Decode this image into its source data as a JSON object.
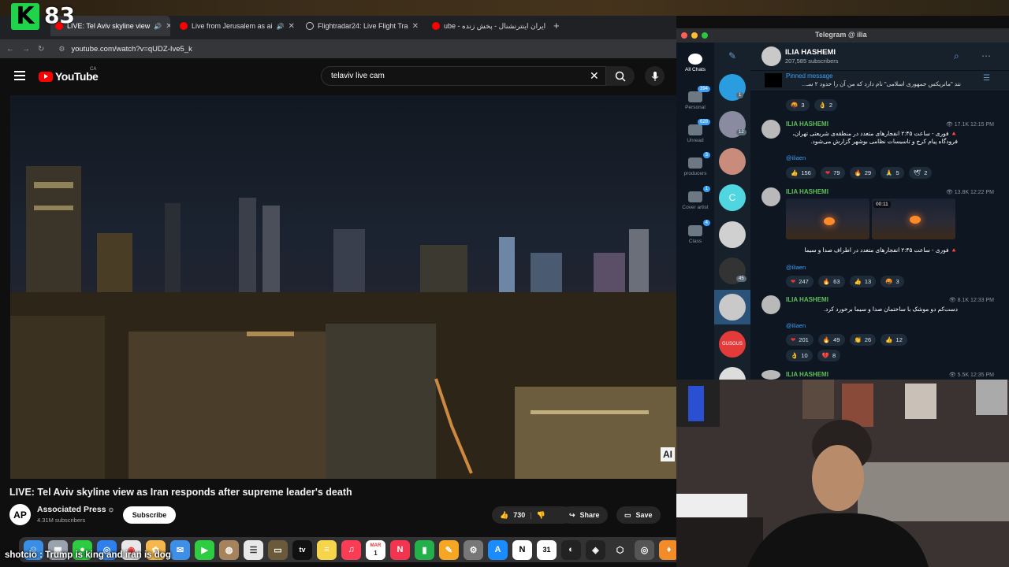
{
  "overlay": {
    "k_letter": "K",
    "count": "83",
    "ticker": "shotcio : Trump is king and iran is dog"
  },
  "browser": {
    "tabs": [
      {
        "label": "LIVE: Tel Aviv skyline view",
        "active": true
      },
      {
        "label": "Live from Jerusalem as ai",
        "active": false
      },
      {
        "label": "Flightradar24: Live Flight Tra",
        "active": false
      },
      {
        "label": "ube - ایران اینترنشنال - پخش زنده",
        "active": false
      }
    ],
    "url": "youtube.com/watch?v=qUDZ-Ive5_k"
  },
  "youtube": {
    "logo_text": "YouTube",
    "region": "CA",
    "search_value": "telaviv live cam",
    "video": {
      "title": "LIVE: Tel Aviv skyline view as Iran responds after supreme leader's death",
      "watermark": "AI"
    },
    "channel": {
      "avatar": "AP",
      "name": "Associated Press",
      "subscribers": "4.31M subscribers",
      "subscribe_label": "Subscribe"
    },
    "actions": {
      "likes": "730",
      "share": "Share",
      "save": "Save"
    }
  },
  "dock": {
    "icons": [
      "finder",
      "launchpad",
      "messages-app",
      "safari",
      "chrome",
      "photos",
      "mail",
      "facetime",
      "contacts",
      "calendar-notes",
      "folder",
      "appletv",
      "notes",
      "music",
      "calendar",
      "news",
      "numbers",
      "sketch",
      "system-preferences",
      "appstore",
      "notion",
      "calendar-31",
      "activity",
      "davinci",
      "unity",
      "disk",
      "fl-studio"
    ],
    "appletv_label": "tv",
    "notion_label": "N",
    "calendar_label": "31",
    "music_label": "MAR",
    "calendar_day": "1"
  },
  "telegram": {
    "window_title": "Telegram @ ilia",
    "folders": [
      {
        "label": "All Chats",
        "badge": ""
      },
      {
        "label": "Personal",
        "badge": "394"
      },
      {
        "label": "Unread",
        "badge": "628"
      },
      {
        "label": "producers",
        "badge": "3"
      },
      {
        "label": "Cover artist",
        "badge": "1"
      },
      {
        "label": "Class",
        "badge": "4"
      }
    ],
    "chat_badges": [
      "1",
      "12",
      "45"
    ],
    "chat_avatar_letter": "C",
    "chat_avatar_logo": "GUSGUS",
    "channel": {
      "name": "ILIA HASHEMI",
      "subscribers": "207,585 subscribers"
    },
    "pinned": {
      "label": "Pinned message",
      "text": "نتد \"ماتریکس جمهوری اسلامی\" نام دارد که من آن را حدود ۲ سـ..."
    },
    "pinned_reactions": [
      {
        "emoji": "🤬",
        "count": "3"
      },
      {
        "emoji": "👌",
        "count": "2"
      }
    ],
    "messages": [
      {
        "author": "ILIA HASHEMI",
        "views": "17.1K",
        "time": "12:15 PM",
        "text": "🔺 فوری - ساعت ۲:۴۵ انفجارهای متعدد در منطقه‌ی شریعتی تهران، فرودگاه پیام کرج و تاسیسات نظامی بوشهر گزارش می‌شود.",
        "handle": "@iliaen",
        "reactions": [
          {
            "emoji": "👍",
            "count": "156"
          },
          {
            "emoji": "❤",
            "count": "79"
          },
          {
            "emoji": "🔥",
            "count": "29"
          },
          {
            "emoji": "🙏",
            "count": "5"
          },
          {
            "emoji": "🕊",
            "count": "2"
          }
        ]
      },
      {
        "author": "ILIA HASHEMI",
        "views": "13.8K",
        "time": "12:22 PM",
        "video_duration": "00:11",
        "text": "🔺 فوری - ساعت ۲:۴۵ انفجارهای متعدد در اطراف صدا و سیما",
        "handle": "@iliaen",
        "reactions": [
          {
            "emoji": "❤",
            "count": "247"
          },
          {
            "emoji": "🔥",
            "count": "63"
          },
          {
            "emoji": "👍",
            "count": "13"
          },
          {
            "emoji": "🤬",
            "count": "3"
          }
        ]
      },
      {
        "author": "ILIA HASHEMI",
        "views": "8.1K",
        "time": "12:33 PM",
        "text": "دست‌کم دو موشک با ساختمان صدا و سیما برخورد کرد.",
        "handle": "@iliaen",
        "reactions": [
          {
            "emoji": "❤",
            "count": "201"
          },
          {
            "emoji": "🔥",
            "count": "49"
          },
          {
            "emoji": "👏",
            "count": "26"
          },
          {
            "emoji": "👍",
            "count": "12"
          },
          {
            "emoji": "👌",
            "count": "10"
          },
          {
            "emoji": "💔",
            "count": "8"
          }
        ]
      },
      {
        "author": "ILIA HASHEMI",
        "views": "5.5K",
        "time": "12:35 PM"
      }
    ]
  },
  "colors": {
    "yt_red": "#ff0000",
    "tg_blue": "#3a9ff7",
    "tg_green_name": "#5fbf5b",
    "k_green": "#1fd34a"
  }
}
